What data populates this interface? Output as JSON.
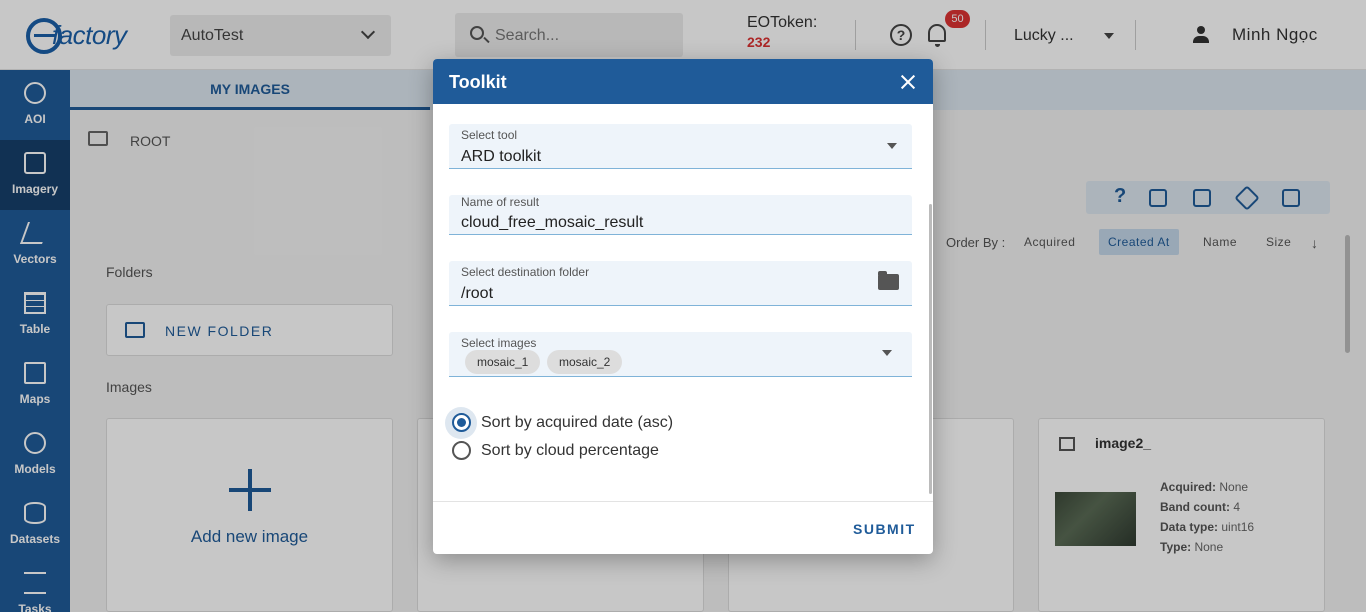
{
  "header": {
    "logo_text": "factory",
    "workspace": "AutoTest",
    "search_placeholder": "Search...",
    "eotoken_label": "EOToken:",
    "eotoken_value": "232",
    "notification_count": "50",
    "org_name": "Lucky ...",
    "user_name": "Minh Ngọc"
  },
  "sidebar": {
    "items": [
      {
        "label": "AOI",
        "icon": "aoi-icon"
      },
      {
        "label": "Imagery",
        "icon": "image-icon"
      },
      {
        "label": "Vectors",
        "icon": "vector-icon"
      },
      {
        "label": "Table",
        "icon": "table-icon"
      },
      {
        "label": "Maps",
        "icon": "map-icon"
      },
      {
        "label": "Models",
        "icon": "models-icon"
      },
      {
        "label": "Datasets",
        "icon": "database-icon"
      },
      {
        "label": "Tasks",
        "icon": "list-icon"
      }
    ]
  },
  "main": {
    "tab_label": "MY IMAGES",
    "breadcrumb_root": "ROOT",
    "order_by_label": "Order By :",
    "sort_options": [
      "Acquired",
      "Created At",
      "Name",
      "Size"
    ],
    "sort_arrow": "↓",
    "folders_label": "Folders",
    "new_folder_label": "NEW FOLDER",
    "images_label": "Images",
    "add_image_label": "Add new image",
    "card": {
      "title": "image2_",
      "acquired_label": "Acquired:",
      "acquired_value": "None",
      "band_label": "Band count:",
      "band_value": "4",
      "dtype_label": "Data type:",
      "dtype_value": "uint16",
      "type_label": "Type:",
      "type_value": "None"
    }
  },
  "modal": {
    "title": "Toolkit",
    "tool_label": "Select tool",
    "tool_value": "ARD toolkit",
    "result_label": "Name of result",
    "result_value": "cloud_free_mosaic_result",
    "folder_label": "Select destination folder",
    "folder_value": "/root",
    "images_label": "Select images",
    "images": [
      "mosaic_1",
      "mosaic_2"
    ],
    "sort_options": [
      {
        "label": "Sort by acquired date (asc)",
        "checked": true
      },
      {
        "label": "Sort by cloud percentage",
        "checked": false
      }
    ],
    "submit_label": "SUBMIT"
  },
  "colors": {
    "brand": "#1f5b99",
    "badge": "#dd3333",
    "eotoken_value": "#dd3333"
  }
}
